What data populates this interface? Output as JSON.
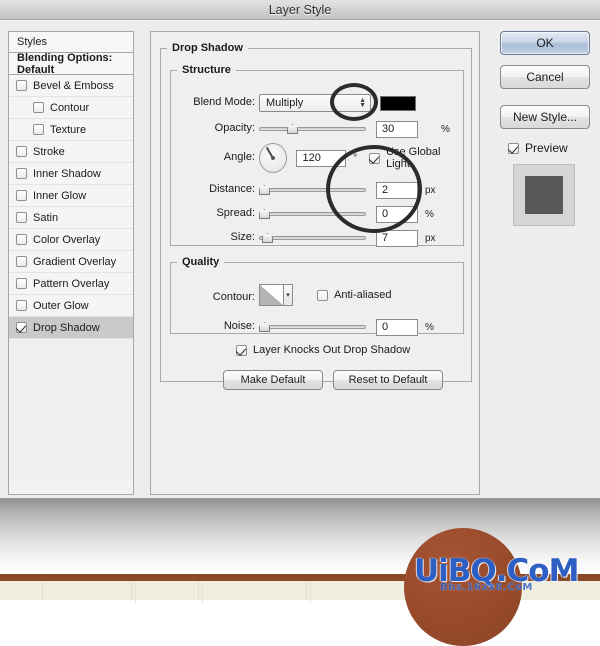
{
  "window": {
    "title": "Layer Style"
  },
  "sidebar": {
    "header": "Styles",
    "blending_options": "Blending Options: Default",
    "items": [
      {
        "label": "Bevel & Emboss",
        "checked": false,
        "indent": false,
        "selected": false
      },
      {
        "label": "Contour",
        "checked": false,
        "indent": true,
        "selected": false
      },
      {
        "label": "Texture",
        "checked": false,
        "indent": true,
        "selected": false
      },
      {
        "label": "Stroke",
        "checked": false,
        "indent": false,
        "selected": false
      },
      {
        "label": "Inner Shadow",
        "checked": false,
        "indent": false,
        "selected": false
      },
      {
        "label": "Inner Glow",
        "checked": false,
        "indent": false,
        "selected": false
      },
      {
        "label": "Satin",
        "checked": false,
        "indent": false,
        "selected": false
      },
      {
        "label": "Color Overlay",
        "checked": false,
        "indent": false,
        "selected": false
      },
      {
        "label": "Gradient Overlay",
        "checked": false,
        "indent": false,
        "selected": false
      },
      {
        "label": "Pattern Overlay",
        "checked": false,
        "indent": false,
        "selected": false
      },
      {
        "label": "Outer Glow",
        "checked": false,
        "indent": false,
        "selected": false
      },
      {
        "label": "Drop Shadow",
        "checked": true,
        "indent": false,
        "selected": true
      }
    ]
  },
  "main": {
    "group_title": "Drop Shadow",
    "structure": {
      "title": "Structure",
      "blend_mode_label": "Blend Mode:",
      "blend_mode_value": "Multiply",
      "shadow_color": "#000000",
      "opacity_label": "Opacity:",
      "opacity_value": "30",
      "opacity_unit": "%",
      "angle_label": "Angle:",
      "angle_value": "120",
      "angle_unit": "°",
      "use_global_light_label": "Use Global Light",
      "use_global_light_checked": true,
      "distance_label": "Distance:",
      "distance_value": "2",
      "distance_unit": "px",
      "spread_label": "Spread:",
      "spread_value": "0",
      "spread_unit": "%",
      "size_label": "Size:",
      "size_value": "7",
      "size_unit": "px"
    },
    "quality": {
      "title": "Quality",
      "contour_label": "Contour:",
      "anti_aliased_label": "Anti-aliased",
      "anti_aliased_checked": false,
      "noise_label": "Noise:",
      "noise_value": "0",
      "noise_unit": "%"
    },
    "knockout_label": "Layer Knocks Out Drop Shadow",
    "knockout_checked": true,
    "make_default_label": "Make Default",
    "reset_default_label": "Reset to Default"
  },
  "buttons": {
    "ok": "OK",
    "cancel": "Cancel",
    "new_style": "New Style...",
    "preview_label": "Preview",
    "preview_checked": true
  },
  "watermark": {
    "text": "UiBQ.CoM",
    "subtext": "Bbs.16xx8.CoM",
    "color": "#2d5fc4",
    "circle_color": "#9a4c2c",
    "line_color": "#8a4a28"
  }
}
